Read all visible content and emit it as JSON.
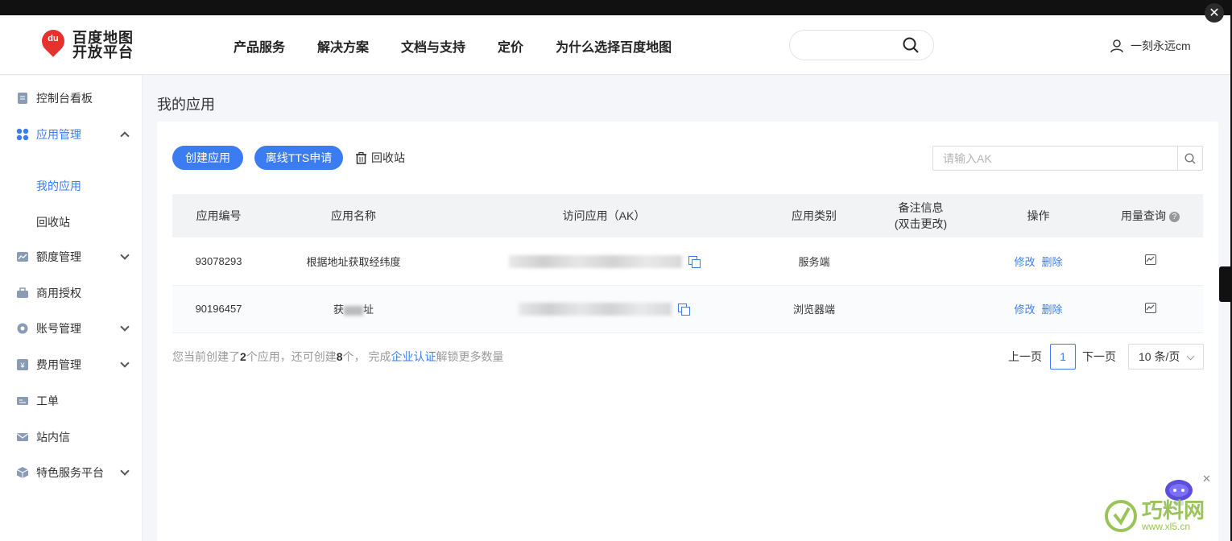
{
  "header": {
    "logo_line1": "百度地图",
    "logo_line2": "开放平台",
    "logo_mark": "du",
    "nav": [
      "产品服务",
      "解决方案",
      "文档与支持",
      "定价",
      "为什么选择百度地图"
    ],
    "username": "一刻永远cm"
  },
  "sidebar": {
    "items": [
      {
        "label": "控制台看板",
        "icon": "dashboard-icon"
      },
      {
        "label": "应用管理",
        "icon": "apps-icon",
        "expanded": true
      },
      {
        "label": "额度管理",
        "icon": "quota-icon"
      },
      {
        "label": "商用授权",
        "icon": "briefcase-icon"
      },
      {
        "label": "账号管理",
        "icon": "gear-icon"
      },
      {
        "label": "费用管理",
        "icon": "billing-icon"
      },
      {
        "label": "工单",
        "icon": "ticket-icon"
      },
      {
        "label": "站内信",
        "icon": "mail-icon"
      },
      {
        "label": "特色服务平台",
        "icon": "cube-icon"
      }
    ],
    "sub_items": [
      "我的应用",
      "回收站"
    ]
  },
  "main": {
    "title": "我的应用",
    "create_btn": "创建应用",
    "tts_btn": "离线TTS申请",
    "recycle": "回收站",
    "ak_placeholder": "请输入AK",
    "columns": [
      "应用编号",
      "应用名称",
      "访问应用（AK）",
      "应用类别",
      "备注信息",
      "(双击更改)",
      "操作",
      "用量查询"
    ],
    "rows": [
      {
        "id": "93078293",
        "name": "根据地址获取经纬度",
        "type": "服务端",
        "edit": "修改",
        "delete": "删除"
      },
      {
        "id": "90196457",
        "name": "获",
        "name_tail": "址",
        "type": "浏览器端",
        "edit": "修改",
        "delete": "删除"
      }
    ],
    "note_prefix": "您当前创建了",
    "note_count": "2",
    "note_mid": "个应用，还可创建",
    "note_remaining": "8",
    "note_mid2": "个，  完成",
    "note_link": "企业认证",
    "note_suffix": "解锁更多数量",
    "pager_prev": "上一页",
    "pager_page": "1",
    "pager_next": "下一页",
    "page_size": "10 条/页"
  },
  "watermark": {
    "text": "巧料网",
    "url": "www.xl5.cn"
  },
  "colors": {
    "accent": "#3c7cf2",
    "logo_red": "#e5322d"
  }
}
